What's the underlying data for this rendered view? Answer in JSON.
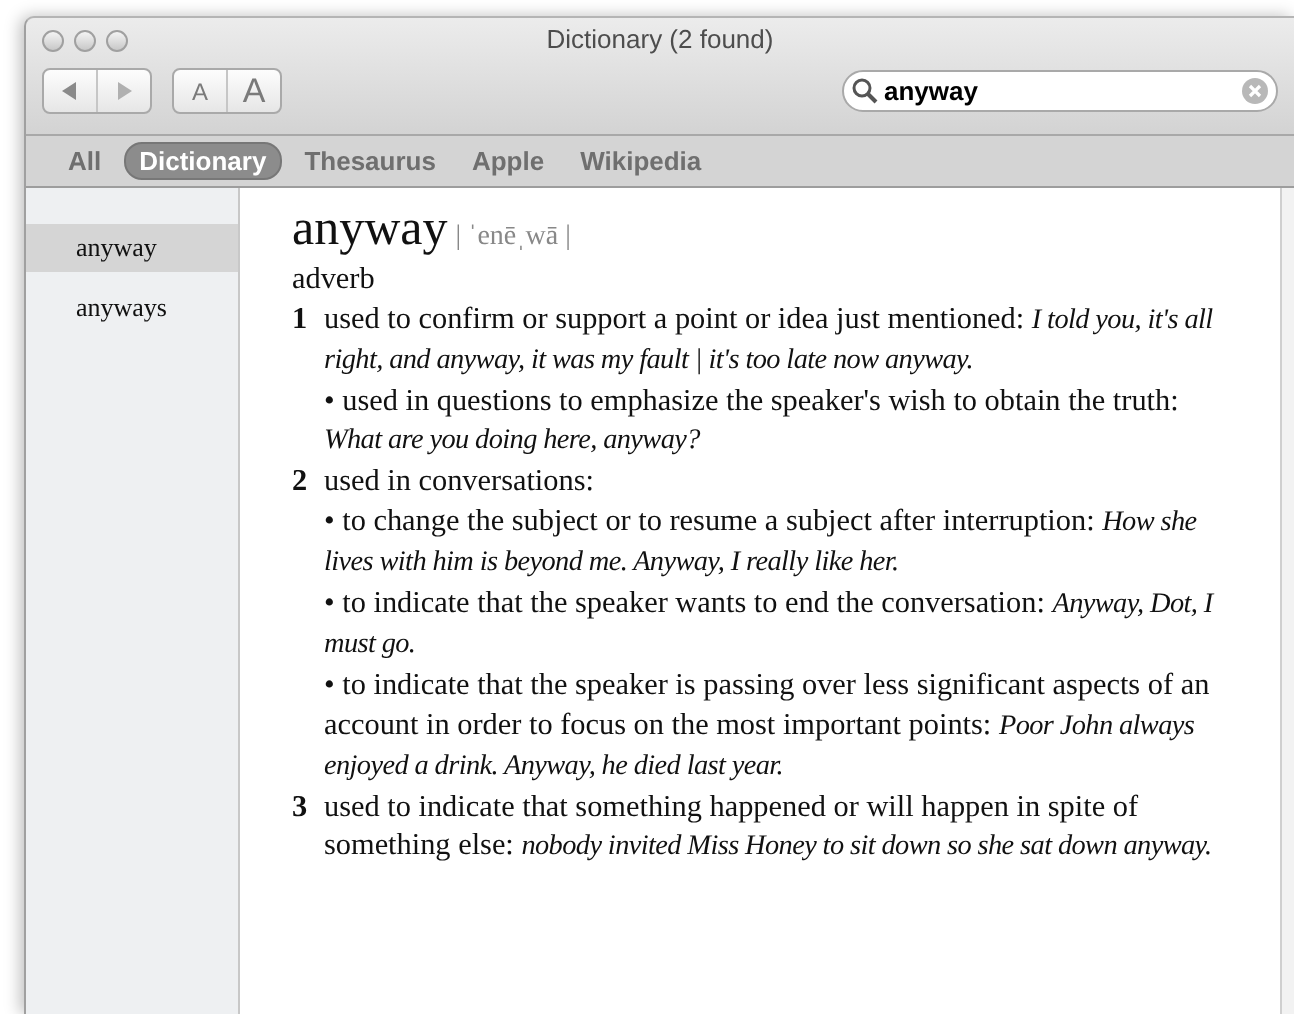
{
  "window": {
    "title": "Dictionary (2 found)"
  },
  "font_buttons": [
    "A",
    "A"
  ],
  "search": {
    "value": "anyway"
  },
  "tabs": [
    {
      "label": "All",
      "selected": false
    },
    {
      "label": "Dictionary",
      "selected": true
    },
    {
      "label": "Thesaurus",
      "selected": false
    },
    {
      "label": "Apple",
      "selected": false
    },
    {
      "label": "Wikipedia",
      "selected": false
    }
  ],
  "results": [
    {
      "label": "anyway",
      "selected": true
    },
    {
      "label": "anyways",
      "selected": false
    }
  ],
  "entry": {
    "headword": "anyway",
    "pronunciation": "| ˈenēˌwā |",
    "part_of_speech": "adverb",
    "senses": [
      {
        "number": "1",
        "text": "used to confirm or support a point or idea just mentioned:",
        "example": "I told you, it's all right, and anyway, it was my fault | it's too late now anyway.",
        "subsenses": [
          {
            "text": "• used in questions to emphasize the speaker's wish to obtain the truth:",
            "example": "What are you doing here, anyway?"
          }
        ]
      },
      {
        "number": "2",
        "text": "used in conversations:",
        "subsenses": [
          {
            "text": "• to change the subject or to resume a subject after interruption:",
            "example": "How she lives with him is beyond me. Anyway, I really like her."
          },
          {
            "text": "• to indicate that the speaker wants to end the conversation:",
            "example": "Anyway, Dot, I must go."
          },
          {
            "text": "• to indicate that the speaker is passing over less significant aspects of an account in order to focus on the most important points:",
            "example": "Poor John always enjoyed a drink. Anyway, he died last year."
          }
        ]
      },
      {
        "number": "3",
        "text": "used to indicate that something happened or will happen in spite of something else:",
        "example": "nobody invited Miss Honey to sit down so she sat down anyway."
      }
    ]
  }
}
